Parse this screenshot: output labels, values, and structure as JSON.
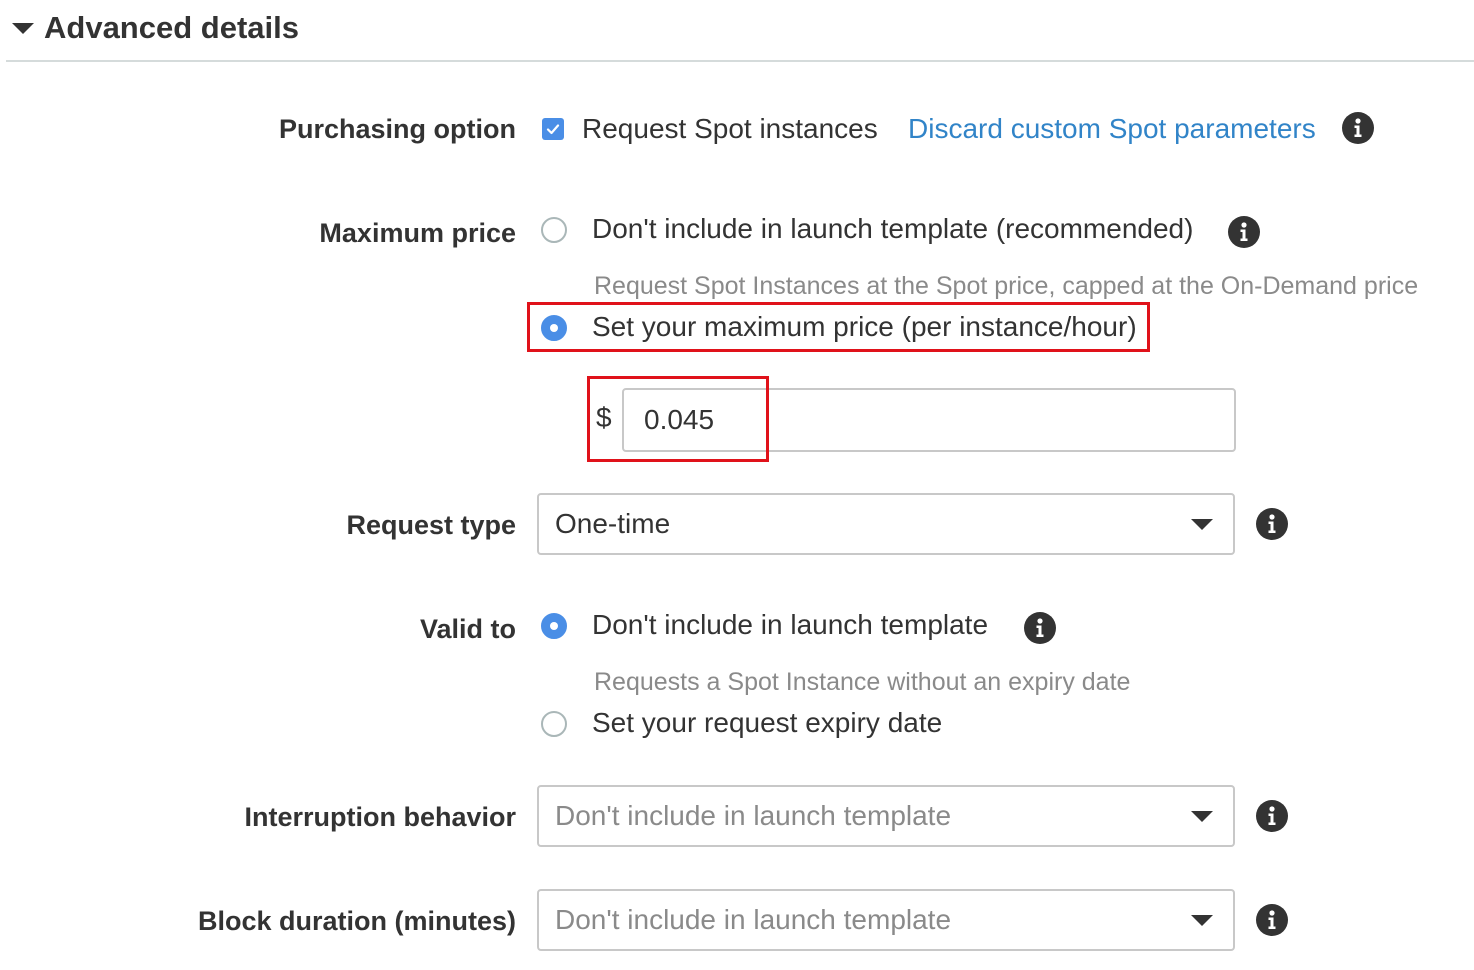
{
  "section": {
    "title": "Advanced details"
  },
  "purchasing": {
    "label": "Purchasing option",
    "checkbox_label": "Request Spot instances",
    "checked": true,
    "link": "Discard custom Spot parameters"
  },
  "max_price": {
    "label": "Maximum price",
    "option1": "Don't include in launch template (recommended)",
    "option1_desc": "Request Spot Instances at the Spot price, capped at the On-Demand price",
    "option2": "Set your maximum price (per instance/hour)",
    "selected": "option2",
    "currency": "$",
    "value": "0.045"
  },
  "request_type": {
    "label": "Request type",
    "value": "One-time"
  },
  "valid_to": {
    "label": "Valid to",
    "option1": "Don't include in launch template",
    "option1_desc": "Requests a Spot Instance without an expiry date",
    "option2": "Set your request expiry date",
    "selected": "option1"
  },
  "interruption": {
    "label": "Interruption behavior",
    "value": "Don't include in launch template"
  },
  "block_duration": {
    "label": "Block duration (minutes)",
    "value": "Don't include in launch template"
  },
  "icons": {
    "section_toggle": "caret-down-icon",
    "info": "info-icon",
    "dropdown": "chevron-down-icon"
  },
  "colors": {
    "accent": "#4a8ee6",
    "link": "#3184c8",
    "highlight": "#e0121a"
  }
}
